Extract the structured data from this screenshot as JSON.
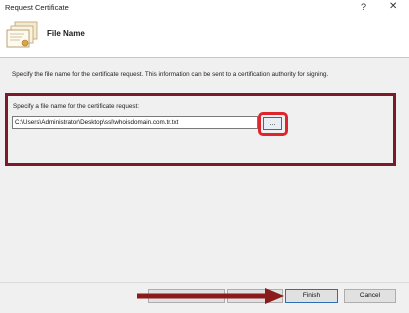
{
  "window": {
    "title": "Request Certificate",
    "help_glyph": "?",
    "close_glyph": "✕"
  },
  "header": {
    "title": "File Name",
    "icon": "certificate-icon"
  },
  "content": {
    "description": "Specify the file name for the certificate request. This information can be sent to a certification authority for signing.",
    "field_label": "Specify a file name for the certificate request:",
    "file_path": "C:\\Users\\Administrator\\Desktop\\ssl\\whoisdomain.com.tr.txt",
    "browse_label": "..."
  },
  "footer": {
    "finish_label": "Finish",
    "cancel_label": "Cancel"
  },
  "colors": {
    "annotation_box": "#7a1a2a",
    "browse_highlight": "#e0242e",
    "arrow": "#8b1a1a"
  }
}
